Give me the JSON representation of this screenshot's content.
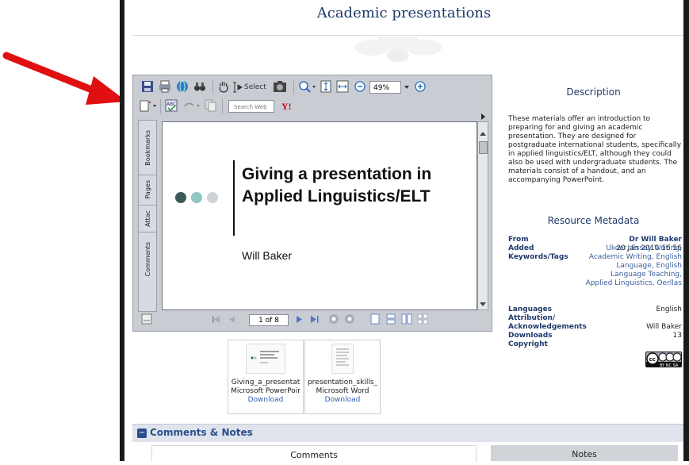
{
  "page_title": "Academic presentations",
  "viewer": {
    "toolbar": {
      "select_label": "Select",
      "zoom_value": "49%",
      "search_placeholder": "Search Web"
    },
    "side_tabs": [
      "Bookmarks",
      "Pages",
      "Attac",
      "Comments"
    ],
    "slide": {
      "title": "Giving a presentation in Applied Linguistics/ELT",
      "author": "Will Baker",
      "dot_colors": [
        "#3d5a5a",
        "#8fc6c6",
        "#cfd3d6"
      ]
    },
    "page_indicator": "1 of 8"
  },
  "attachments": [
    {
      "name": "Giving_a_presentat",
      "type": "Microsoft PowerPoir",
      "link": "Download",
      "thumb_text": "Giving a presentation in Applied Linguistics/ELT"
    },
    {
      "name": "presentation_skills_",
      "type": "Microsoft Word",
      "link": "Download"
    }
  ],
  "description": {
    "heading": "Description",
    "text": "These materials offer an introduction to preparing for and giving an academic presentation. They are designed for postgraduate international students, specifically in applied linguistics/ELT, although they could also be used with undergraduate students. The materials consist of a handout, and an accompanying PowerPoint."
  },
  "metadata": {
    "heading": "Resource Metadata",
    "from_label": "From",
    "from_value": "Dr Will Baker",
    "added_label": "Added",
    "added_value": "20 Jan 2010 16:56",
    "keywords_label": "Keywords/Tags",
    "keywords_value": "Ukoer, Essay Writing, Academic Writing, English Language, English Language Teaching, Applied Linguistics, Oerllas",
    "languages_label": "Languages",
    "languages_value": "English",
    "attribution_label": "Attribution/",
    "ack_label": "Acknowledgements",
    "ack_value": "Will Baker",
    "downloads_label": "Downloads",
    "downloads_value": "13",
    "copyright_label": "Copyright",
    "license_badge": "cc by nc sa"
  },
  "comments_section": {
    "title": "Comments & Notes",
    "toggle": "−",
    "comments_tab": "Comments",
    "notes_tab": "Notes"
  }
}
